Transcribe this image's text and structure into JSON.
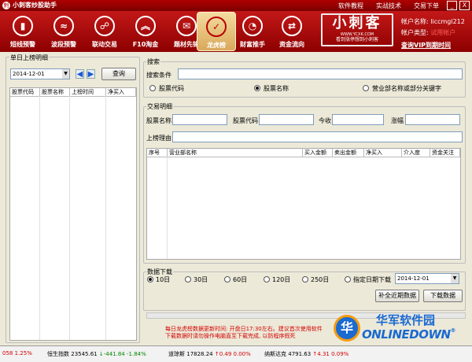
{
  "window": {
    "title": "小刺客炒股助手",
    "minimize": "_",
    "close": "X"
  },
  "nav": [
    {
      "label": "短线预警",
      "icon": "bar-chart-icon",
      "glyph": "▮"
    },
    {
      "label": "波段预警",
      "icon": "alarm-icon",
      "glyph": "≈"
    },
    {
      "label": "联动交易",
      "icon": "link-icon",
      "glyph": "☍"
    },
    {
      "label": "F10淘金",
      "icon": "chevron-up-icon",
      "glyph": "︽"
    },
    {
      "label": "题材先锋",
      "icon": "mail-icon",
      "glyph": "✉"
    },
    {
      "label": "龙虎榜",
      "icon": "check-icon",
      "glyph": "✓"
    },
    {
      "label": "财富推手",
      "icon": "pie-icon",
      "glyph": "◔"
    },
    {
      "label": "资金流向",
      "icon": "flow-icon",
      "glyph": "⇄"
    }
  ],
  "toplinks": [
    "软件教程",
    "实战技术",
    "交易下单"
  ],
  "logo": {
    "big": "小刺客",
    "url": "WWW.YCXK.COM",
    "slogan": "看到涨停想到小刺客"
  },
  "account": {
    "name_label": "帐户名称:",
    "name_value": "liccmgl212",
    "type_label": "帐户类型:",
    "type_value": "试用帐户",
    "renew": "查询VIP到期时间"
  },
  "left": {
    "title": "单日上榜明细",
    "date": "2014-12-01",
    "query_button": "查询",
    "columns": [
      "股票代码",
      "股票名称",
      "上榜时间",
      "净买入"
    ]
  },
  "search": {
    "title": "搜索",
    "condition_label": "搜索条件",
    "options": [
      "股票代码",
      "股票名称",
      "营业部名称或部分关键字"
    ],
    "selected": 1
  },
  "detail": {
    "title": "交易明细",
    "fields": [
      "股票名称",
      "股票代码",
      "今收",
      "涨幅"
    ],
    "reason_label": "上榜理由",
    "columns": [
      "序号",
      "营业部名称",
      "买入金额",
      "卖出金额",
      "净买入",
      "介入度",
      "资金关注"
    ]
  },
  "download": {
    "title": "数据下载",
    "options": [
      "10日",
      "30日",
      "60日",
      "120日",
      "250日",
      "指定日期下载"
    ],
    "selected": 0,
    "date": "2014-12-01",
    "supplement_button": "补全近期数据",
    "download_button": "下载数据"
  },
  "notice": {
    "line1": "每日龙虎榜数据更新时间: 开盘日17:30左右。建议首次使用软件",
    "line2": "下载数据时请勿操作电脑直至下载完成, 以防程序假死"
  },
  "watermark": {
    "cn": "华军软件园",
    "en": "ONLINEDOWN",
    "tm": "®",
    "logo_glyph": "华"
  },
  "ticker": [
    {
      "name": "058",
      "value": "",
      "change": "1.25%",
      "dir": "up"
    },
    {
      "name": "恒生指数",
      "value": "23545.61",
      "change": "↓-441.84 -1.84%",
      "dir": "dn"
    },
    {
      "name": "道琼斯",
      "value": "17828.24",
      "change": "↑0.49 0.00%",
      "dir": "up"
    },
    {
      "name": "纳斯达克",
      "value": "4791.63",
      "change": "↑4.31 0.09%",
      "dir": "up"
    }
  ],
  "colors": {
    "brand_red": "#b00000",
    "accent_blue": "#1a6ad1"
  }
}
